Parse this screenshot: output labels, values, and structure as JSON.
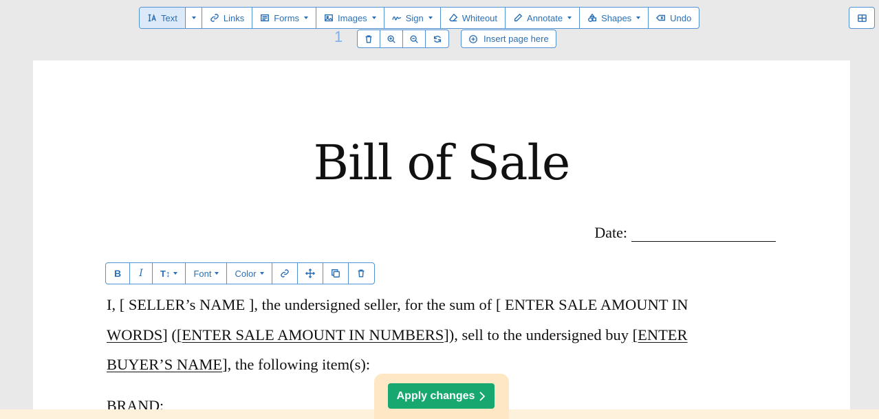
{
  "toolbar": {
    "text_label": "Text",
    "links_label": "Links",
    "forms_label": "Forms",
    "images_label": "Images",
    "sign_label": "Sign",
    "whiteout_label": "Whiteout",
    "annotate_label": "Annotate",
    "shapes_label": "Shapes",
    "undo_label": "Undo"
  },
  "page_toolbar": {
    "page_number": "1",
    "insert_label": "Insert page here"
  },
  "document": {
    "title": "Bill of Sale",
    "date_label": "Date:",
    "para_1a": "I, [ SELLER’s NAME ], the undersigned seller, for the sum of [ ENTER SALE AMOUNT IN",
    "para_2a": "WORDS",
    "para_2b": "] (",
    "para_2c": "[ENTER SALE AMOUNT IN NUMBERS",
    "para_2d": "]), sell to the undersigned buy ",
    "para_2e": "[ENTER",
    "para_3a": "BUYER’S NAME",
    "para_3b": "], the following item(s):",
    "brand_label": "BRAND:"
  },
  "format_bar": {
    "bold": "B",
    "italic": "I",
    "size": "T↕",
    "font_label": "Font",
    "color_label": "Color"
  },
  "footer": {
    "apply_label": "Apply changes"
  },
  "colors": {
    "accent": "#2a6fb5",
    "border": "#4f93d6",
    "apply": "#17a870"
  }
}
